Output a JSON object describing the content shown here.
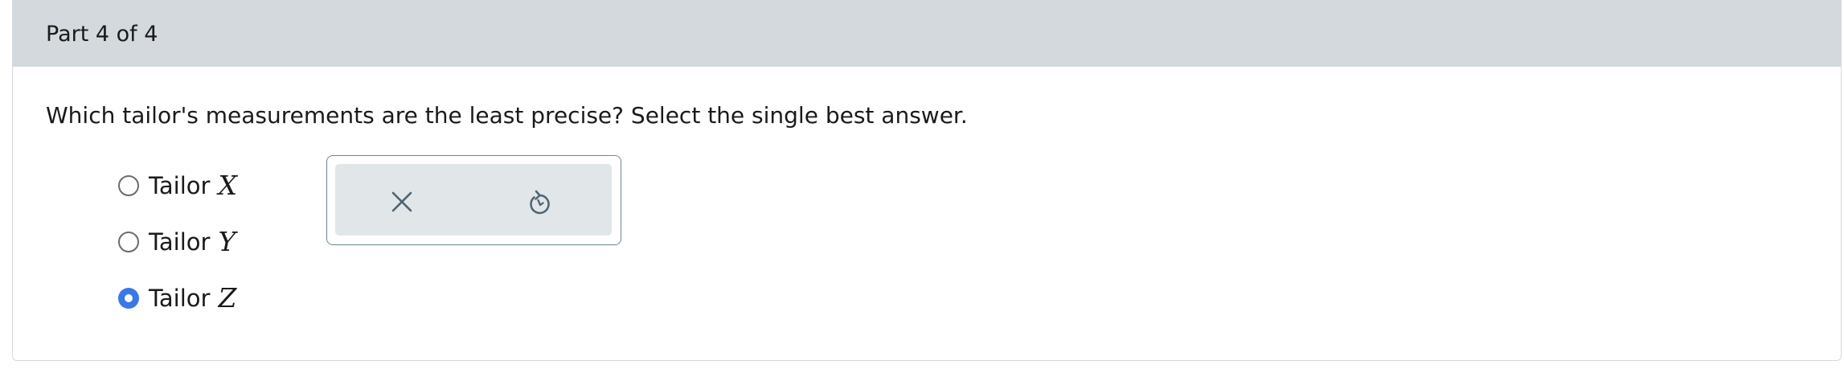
{
  "header": {
    "part_label": "Part 4 of 4"
  },
  "question": {
    "text": "Which tailor's measurements are the least precise? Select the single best answer."
  },
  "options": [
    {
      "label": "Tailor",
      "variable": "X",
      "selected": false
    },
    {
      "label": "Tailor",
      "variable": "Y",
      "selected": false
    },
    {
      "label": "Tailor",
      "variable": "Z",
      "selected": true
    }
  ],
  "toolbox": {
    "buttons": [
      {
        "icon": "close-icon",
        "action": "clear"
      },
      {
        "icon": "undo-icon",
        "action": "undo"
      }
    ]
  },
  "colors": {
    "header_bg": "#d3d9dd",
    "radio_selected": "#3a78e8",
    "toolbox_bg": "#e1e6e9",
    "icon": "#4d6472"
  }
}
